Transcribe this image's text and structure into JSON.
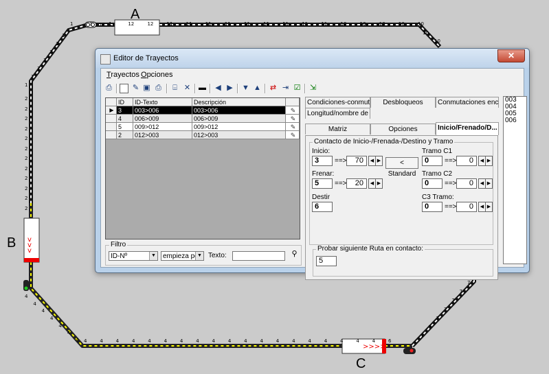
{
  "layout_labels": {
    "a": "A",
    "b": "B",
    "c": "C"
  },
  "track": {
    "top_block_num": "12",
    "top_numbers": [
      "1",
      "1",
      "1",
      "12",
      "12",
      "11",
      "11",
      "11",
      "11",
      "11",
      "11",
      "11",
      "11",
      "11",
      "10",
      "10",
      "10",
      "10",
      "10"
    ],
    "right_numbers": [
      "10",
      "10"
    ],
    "left_upper_numbers": [
      "1",
      "1",
      "1",
      "1",
      "1",
      "1",
      "1"
    ],
    "left_lower_numbers": [
      "2",
      "2",
      "2",
      "2",
      "2",
      "2",
      "2",
      "2",
      "2",
      "2",
      "2",
      "2"
    ],
    "left_bottom_numbers": [
      "4",
      "4",
      "4",
      "4",
      "4",
      "4",
      "4"
    ],
    "bottom_numbers": [
      "4",
      "4",
      "4",
      "4",
      "4",
      "4",
      "4",
      "4",
      "4",
      "4",
      "4",
      "4",
      "4",
      "4",
      "4",
      "4",
      "4",
      "4",
      "4",
      "6"
    ],
    "right_lower_numbers": [
      "7",
      "7",
      "7",
      "7",
      "7",
      "7",
      "7"
    ]
  },
  "window": {
    "title": "Editor de Trayectos",
    "close_label": "✕",
    "menu": [
      "Trayectos",
      "Opciones"
    ]
  },
  "grid": {
    "headers": [
      "ID",
      "ID-Texto",
      "Descripción"
    ],
    "rows": [
      {
        "indicator": "▶",
        "id": "3",
        "text": "003>006",
        "desc": "003>006"
      },
      {
        "indicator": "",
        "id": "4",
        "text": "006>009",
        "desc": "006>009"
      },
      {
        "indicator": "",
        "id": "5",
        "text": "009>012",
        "desc": "009>012"
      },
      {
        "indicator": "",
        "id": "2",
        "text": "012>003",
        "desc": "012>003"
      }
    ]
  },
  "filter": {
    "label": "Filtro",
    "field": "ID-Nº",
    "mode": "empieza por",
    "text_label": "Texto:",
    "text_value": ""
  },
  "tabs": {
    "row1": [
      "Condiciones-conmuta...",
      "Desbloqueos",
      "Conmutaciones enca..."
    ],
    "row2": [
      "Longitud/nombre de t..."
    ],
    "row3": [
      "Matriz",
      "Opciones",
      "Inicio/Frenado/D..."
    ]
  },
  "panel": {
    "group_title": "Contacto de Inicio-/Frenada-/Destino y Tramo",
    "inicio": {
      "label": "Inicio:",
      "value": "3",
      "arrow": "==>",
      "pos": "70"
    },
    "frenar": {
      "label": "Frenar:",
      "value": "5",
      "arrow": "==>",
      "pos": "20"
    },
    "destino": {
      "label": "Destir",
      "value": "6"
    },
    "standard_button": "< Standard",
    "tramo_c1": {
      "label": "Tramo C1",
      "value": "0",
      "arrow": "==>",
      "pos": "0"
    },
    "tramo_c2": {
      "label": "Tramo C2",
      "value": "0",
      "arrow": "==>",
      "pos": "0"
    },
    "tramo_c3": {
      "label": "C3 Tramo:",
      "value": "0",
      "arrow": "==>",
      "pos": "0"
    },
    "probar_label": "Probar siguiente Ruta en contacto:",
    "probar_value": "5"
  },
  "route_list": [
    "003",
    "004",
    "005",
    "006"
  ]
}
